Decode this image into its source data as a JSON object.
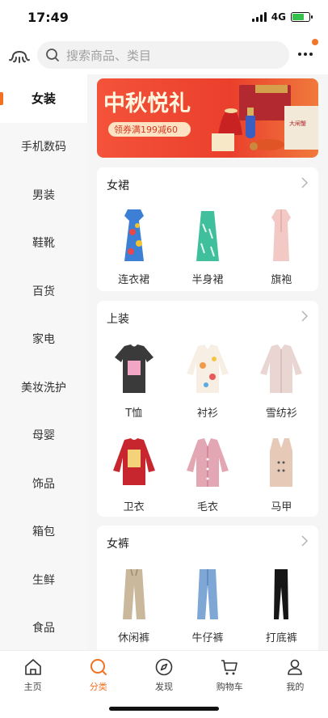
{
  "status_bar": {
    "time": "17:49",
    "network": "4G"
  },
  "search": {
    "placeholder": "搜索商品、类目"
  },
  "sidebar": {
    "items": [
      {
        "label": "女装",
        "active": true
      },
      {
        "label": "手机数码"
      },
      {
        "label": "男装"
      },
      {
        "label": "鞋靴"
      },
      {
        "label": "百货"
      },
      {
        "label": "家电"
      },
      {
        "label": "美妆洗护"
      },
      {
        "label": "母婴"
      },
      {
        "label": "饰品"
      },
      {
        "label": "箱包"
      },
      {
        "label": "生鲜"
      },
      {
        "label": "食品"
      }
    ]
  },
  "banner": {
    "title": "中秋悦礼",
    "coupon": "领券满199减60",
    "package_text": "大闸蟹"
  },
  "sections": [
    {
      "title": "女裙",
      "items": [
        {
          "label": "连衣裙",
          "icon": "floral-dress-icon"
        },
        {
          "label": "半身裙",
          "icon": "skirt-icon"
        },
        {
          "label": "旗袍",
          "icon": "qipao-icon"
        }
      ]
    },
    {
      "title": "上装",
      "items": [
        {
          "label": "T恤",
          "icon": "tshirt-icon"
        },
        {
          "label": "衬衫",
          "icon": "shirt-icon"
        },
        {
          "label": "雪纺衫",
          "icon": "chiffon-blouse-icon"
        },
        {
          "label": "卫衣",
          "icon": "sweatshirt-icon"
        },
        {
          "label": "毛衣",
          "icon": "cardigan-icon"
        },
        {
          "label": "马甲",
          "icon": "vest-icon"
        }
      ]
    },
    {
      "title": "女裤",
      "items": [
        {
          "label": "休闲裤",
          "icon": "casual-pants-icon"
        },
        {
          "label": "牛仔裤",
          "icon": "jeans-icon"
        },
        {
          "label": "打底裤",
          "icon": "leggings-icon"
        }
      ]
    }
  ],
  "tabbar": {
    "items": [
      {
        "label": "主页",
        "icon": "home-icon"
      },
      {
        "label": "分类",
        "icon": "search-icon",
        "active": true
      },
      {
        "label": "发现",
        "icon": "compass-icon"
      },
      {
        "label": "购物车",
        "icon": "cart-icon"
      },
      {
        "label": "我的",
        "icon": "user-icon"
      }
    ]
  },
  "colors": {
    "accent": "#f37021",
    "banner_red": "#e8452c"
  }
}
